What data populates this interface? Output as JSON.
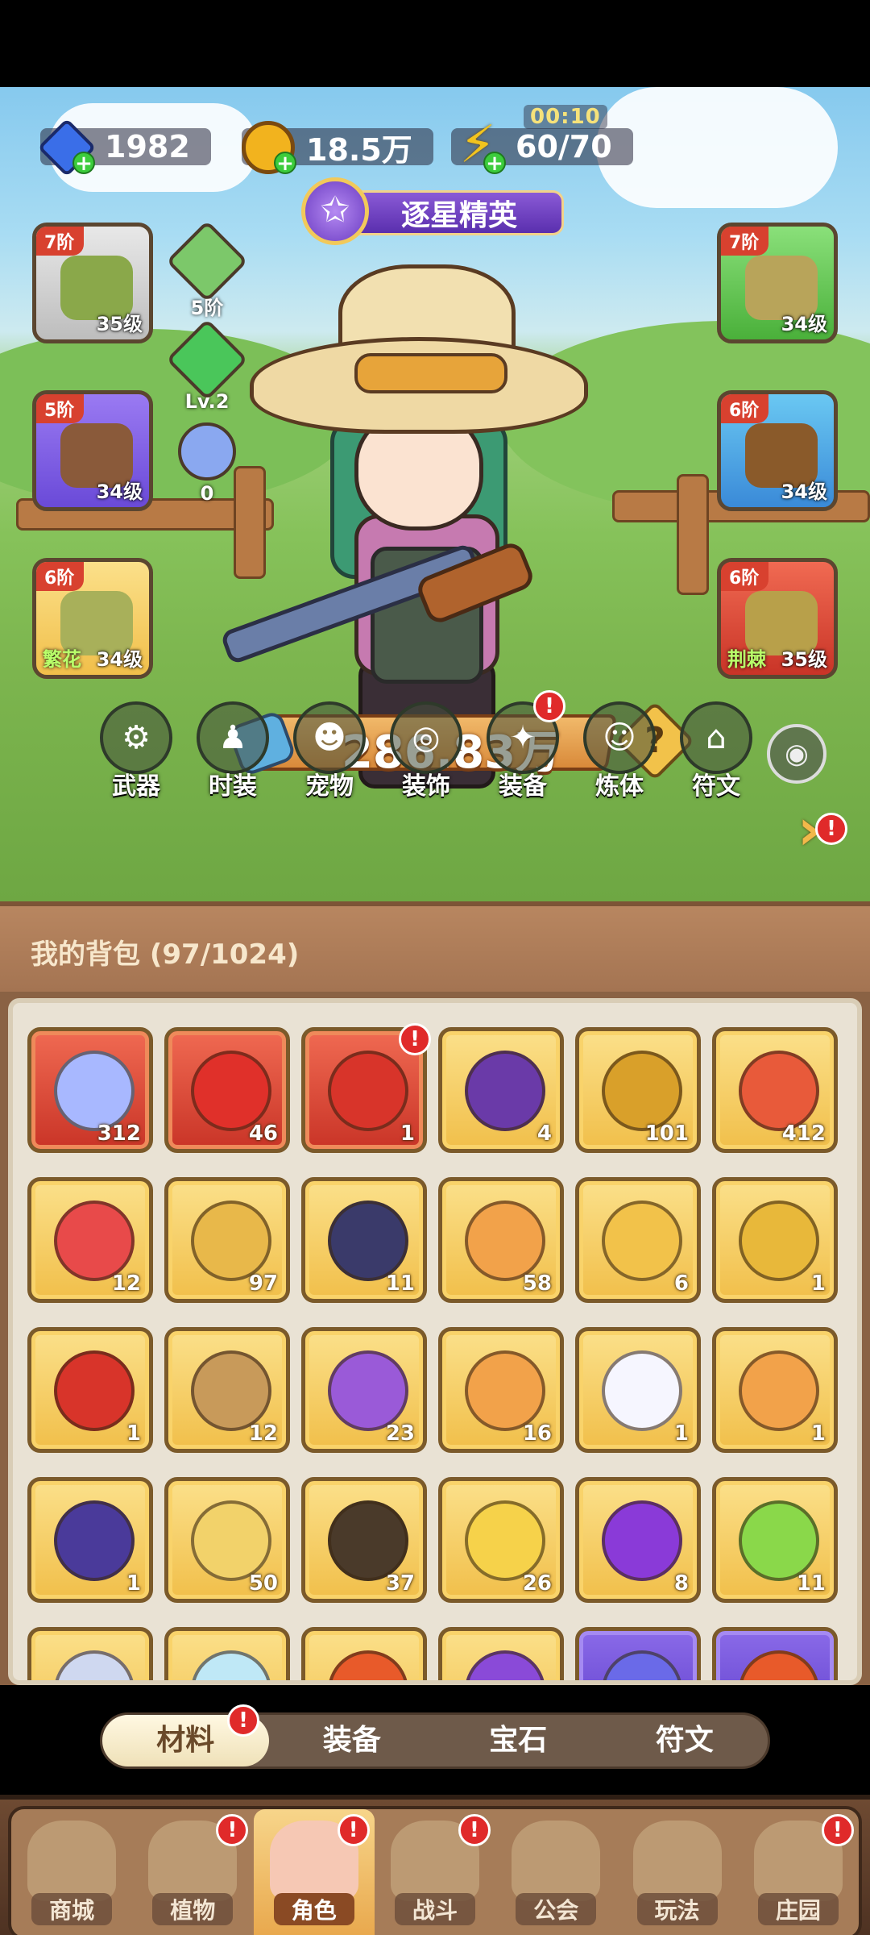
{
  "currencies": [
    {
      "name": "diamond",
      "value": "1982",
      "color": "#3a6ee8",
      "icon": "diamond-icon"
    },
    {
      "name": "gold",
      "value": "18.5万",
      "color": "#f2b31e",
      "icon": "coin-icon"
    },
    {
      "name": "energy",
      "value": "60/70",
      "color": "#f2c41e",
      "icon": "lightning-icon"
    }
  ],
  "energy_timer": "00:10",
  "rank": {
    "title": "逐星精英",
    "icon": "star-medal-icon"
  },
  "gear": {
    "left": [
      {
        "tier": "7阶",
        "level": "35级",
        "set": "",
        "color": "#cfcfcf",
        "icon": "hat-icon"
      },
      {
        "tier": "5阶",
        "level": "34级",
        "set": "",
        "color": "#7a5ad8",
        "icon": "glove-icon"
      },
      {
        "tier": "6阶",
        "level": "34级",
        "set": "繁花",
        "color": "#f2c84a",
        "icon": "pants-icon"
      }
    ],
    "right": [
      {
        "tier": "7阶",
        "level": "34级",
        "set": "",
        "color": "#6ccf5a",
        "icon": "vest-icon"
      },
      {
        "tier": "6阶",
        "level": "34级",
        "set": "",
        "color": "#4aa8e8",
        "icon": "belt-icon"
      },
      {
        "tier": "6阶",
        "level": "35级",
        "set": "荆棘",
        "color": "#e64a3a",
        "icon": "boots-icon"
      }
    ]
  },
  "mini_stats": [
    {
      "label": "5阶",
      "color": "#7cc86a",
      "icon": "book-icon"
    },
    {
      "label": "Lv.2",
      "color": "#4ac65a",
      "icon": "green-gem-icon"
    },
    {
      "label": "0",
      "color": "#8aa8f0",
      "icon": "orbit-icon"
    }
  ],
  "power": "286.83万",
  "help_symbol": "?",
  "menu": [
    {
      "label": "武器",
      "icon": "weapon-icon",
      "badge": false
    },
    {
      "label": "时装",
      "icon": "outfit-icon",
      "badge": false
    },
    {
      "label": "宠物",
      "icon": "pet-icon",
      "badge": false
    },
    {
      "label": "装饰",
      "icon": "mask-icon",
      "badge": false
    },
    {
      "label": "装备",
      "icon": "equip-icon",
      "badge": true
    },
    {
      "label": "炼体",
      "icon": "body-icon",
      "badge": false
    },
    {
      "label": "符文",
      "icon": "rune-icon",
      "badge": false
    }
  ],
  "backpack": {
    "title": "我的背包 (97/1024)",
    "items": [
      {
        "count": "312",
        "rarity": "red",
        "color": "#a8b8ff",
        "icon": "crystal-star-icon"
      },
      {
        "count": "46",
        "rarity": "red",
        "color": "#e0302a",
        "icon": "potion-icon"
      },
      {
        "count": "1",
        "rarity": "red",
        "color": "#d8342a",
        "icon": "red-envelope-icon",
        "badge": true
      },
      {
        "count": "4",
        "rarity": "gold",
        "color": "#6a3aa8",
        "icon": "skull-scroll-icon"
      },
      {
        "count": "101",
        "rarity": "gold",
        "color": "#d9a02a",
        "icon": "coin-icon"
      },
      {
        "count": "412",
        "rarity": "gold",
        "color": "#e85a3a",
        "icon": "lucky-bag-icon"
      },
      {
        "count": "12",
        "rarity": "gold",
        "color": "#e84a4a",
        "icon": "ruby-key-icon"
      },
      {
        "count": "97",
        "rarity": "gold",
        "color": "#e8b84a",
        "icon": "key-icon"
      },
      {
        "count": "11",
        "rarity": "gold",
        "color": "#3a3a6a",
        "icon": "rune-stone-icon"
      },
      {
        "count": "58",
        "rarity": "gold",
        "color": "#f2a24a",
        "icon": "elixir-icon"
      },
      {
        "count": "6",
        "rarity": "gold",
        "color": "#f2c24a",
        "icon": "crystal-pile-icon"
      },
      {
        "count": "1",
        "rarity": "gold",
        "color": "#e8b83a",
        "icon": "ore-icon"
      },
      {
        "count": "1",
        "rarity": "gold",
        "color": "#d8342a",
        "icon": "flower-icon"
      },
      {
        "count": "12",
        "rarity": "gold",
        "color": "#c89a5a",
        "icon": "flower-pot-icon"
      },
      {
        "count": "23",
        "rarity": "gold",
        "color": "#9a5ad8",
        "icon": "spell-book-icon"
      },
      {
        "count": "16",
        "rarity": "gold",
        "color": "#f2a24a",
        "icon": "can-icon"
      },
      {
        "count": "1",
        "rarity": "gold",
        "color": "#f6f6ff",
        "icon": "rabbit-piece-icon"
      },
      {
        "count": "1",
        "rarity": "gold",
        "color": "#f2a24a",
        "icon": "fox-piece-icon"
      },
      {
        "count": "1",
        "rarity": "gold",
        "color": "#4a3a9a",
        "icon": "wizard-piece-icon"
      },
      {
        "count": "50",
        "rarity": "gold",
        "color": "#f2d26a",
        "icon": "feather-icon"
      },
      {
        "count": "37",
        "rarity": "gold",
        "color": "#4a3a2a",
        "icon": "card-icon"
      },
      {
        "count": "26",
        "rarity": "gold",
        "color": "#f6d24a",
        "icon": "golden-flower-icon"
      },
      {
        "count": "8",
        "rarity": "gold",
        "color": "#8a3ad8",
        "icon": "berry-icon"
      },
      {
        "count": "11",
        "rarity": "gold",
        "color": "#8ad84a",
        "icon": "frog-icon"
      },
      {
        "count": "",
        "rarity": "gold",
        "color": "#cfd8f0",
        "icon": "knight-piece-icon"
      },
      {
        "count": "",
        "rarity": "gold",
        "color": "#bfe8f6",
        "icon": "sprout-icon"
      },
      {
        "count": "",
        "rarity": "gold",
        "color": "#e85a2a",
        "icon": "flame-icon"
      },
      {
        "count": "",
        "rarity": "gold",
        "color": "#8a4ad8",
        "icon": "demon-icon"
      },
      {
        "count": "",
        "rarity": "purple",
        "color": "#6a6ae8",
        "icon": "vial-icon"
      },
      {
        "count": "",
        "rarity": "purple",
        "color": "#e85a2a",
        "icon": "lantern-icon"
      }
    ]
  },
  "tabs": [
    {
      "label": "材料",
      "active": true,
      "badge": true
    },
    {
      "label": "装备",
      "active": false,
      "badge": false
    },
    {
      "label": "宝石",
      "active": false,
      "badge": false
    },
    {
      "label": "符文",
      "active": false,
      "badge": false
    }
  ],
  "nav": [
    {
      "label": "商城",
      "active": false,
      "badge": false,
      "icon": "shop-icon"
    },
    {
      "label": "植物",
      "active": false,
      "badge": true,
      "icon": "plant-icon"
    },
    {
      "label": "角色",
      "active": true,
      "badge": true,
      "icon": "character-icon"
    },
    {
      "label": "战斗",
      "active": false,
      "badge": true,
      "icon": "battle-icon"
    },
    {
      "label": "公会",
      "active": false,
      "badge": false,
      "icon": "guild-icon"
    },
    {
      "label": "玩法",
      "active": false,
      "badge": false,
      "icon": "play-icon"
    },
    {
      "label": "庄园",
      "active": false,
      "badge": true,
      "icon": "manor-icon"
    }
  ],
  "badge_symbol": "!"
}
